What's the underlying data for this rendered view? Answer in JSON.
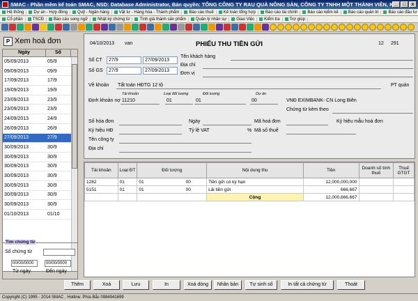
{
  "window": {
    "title": "SMAC - Phần mềm kế toán SMAC, NSD: Database Administrator, Bản quyền: TỔNG CÔNG TY RAU QUẢ NÔNG SẢN, CÔNG TY TNHH MỘT THÀNH VIÊN, K...",
    "minimize": "_",
    "maximize": "□",
    "close": "x"
  },
  "menu1": [
    "Hệ thống",
    "Dự án - Hợp đồng",
    "Quỹ - Ngân hàng",
    "Vật tư - Hàng hóa - Thành phẩm",
    "Báo cáo thuế",
    "Kế toán tổng hợp",
    "Báo cáo tài chính",
    "Báo cáo kiểm kê",
    "Báo cáo quản trị",
    "Báo cáo đầu tư - XDCB"
  ],
  "menu2": [
    "Cổ phần",
    "TSCĐ",
    "Báo cáo song ngữ",
    "Nhật ký chứng từ",
    "Tình giá thành sản phẩm",
    "Quản lý nhân sự",
    "Giao Việc",
    "Kiểm tra",
    "Trợ giúp"
  ],
  "left": {
    "p_button": "P",
    "title": "Xem hoá đơn",
    "col_date": "Ngày",
    "col_num": "Số",
    "rows": [
      {
        "date": "05/09/2013",
        "num": "05/9"
      },
      {
        "date": "09/09/2013",
        "num": "09/9"
      },
      {
        "date": "17/09/2013",
        "num": "17/9"
      },
      {
        "date": "19/09/2013",
        "num": "19/9"
      },
      {
        "date": "23/09/2013",
        "num": "23/9"
      },
      {
        "date": "23/09/2013",
        "num": "23/9"
      },
      {
        "date": "24/09/2013",
        "num": "24/9"
      },
      {
        "date": "26/09/2013",
        "num": "26/9"
      },
      {
        "date": "27/09/2013",
        "num": "27/9"
      },
      {
        "date": "30/09/2013",
        "num": "30/9"
      },
      {
        "date": "30/09/2013",
        "num": "30/9"
      },
      {
        "date": "30/09/2013",
        "num": "30/9"
      },
      {
        "date": "30/09/2013",
        "num": "30/9"
      },
      {
        "date": "30/09/2013",
        "num": "30/9"
      },
      {
        "date": "30/09/2013",
        "num": "30/9"
      },
      {
        "date": "30/09/2013",
        "num": "30/9"
      },
      {
        "date": "01/10/2013",
        "num": "01/10"
      }
    ],
    "selected_index": 8,
    "search": {
      "legend": "Tìm chứng từ",
      "so_chung_tu_label": "Số chứng từ",
      "so_chung_tu_value": "",
      "tu_ngay_value": "00/00/0000",
      "den_ngay_value": "00/00/0000",
      "tu_ngay_label": "Từ ngày",
      "den_ngay_label": "Đến ngày"
    }
  },
  "form": {
    "header_date": "04/10/2013",
    "header_user": "van",
    "title": "PHIẾU THU TIỀN GỬI",
    "page_a": "12",
    "page_b": "291",
    "so_ct_label": "Số CT",
    "so_ct_value": "27/9",
    "so_ct_date": "27/09/2013",
    "so_gs_label": "Số GS",
    "so_gs_value": "27/9",
    "so_gs_date": "27/09/2013",
    "ten_kh_label": "Tên khách hàng",
    "dia_chi_label": "Địa chỉ",
    "don_vi_label": "Đơn vị",
    "ve_khoan_label": "Về khoản",
    "ve_khoan_value": "Tất toán HĐTG 12 tộ",
    "pt_quan_label": "PT quản",
    "sub_tai_khoan": "Tài khoản",
    "sub_loai_dt": "Loại đối tượng",
    "sub_doi_tuong": "Đối tượng",
    "sub_du_an": "Dự án",
    "dinh_khoan_label": "Định khoản nợ",
    "tk_value": "11210",
    "loai_value": "01",
    "dt_value": "01",
    "da_value": "00",
    "bank_value": "VNĐ EXIMBANK- CN Long Biên",
    "ctkt_label": "Chứng từ kèm theo",
    "so_hoa_don_label": "Số hóa đơn",
    "ngay_label": "Ngày",
    "ma_hoa_don_label": "Mã hoá đơn",
    "ky_hieu_mau_label": "Ký hiệu mẫu hoá đơn",
    "ky_hieu_hd_label": "Ký hiệu HĐ",
    "ty_le_vat_label": "Tỷ lệ VAT",
    "percent": "%",
    "ma_so_thue_label": "Mã số thuế",
    "ten_cong_ty_label": "Tên công ty",
    "dia_chi2_label": "Địa chỉ"
  },
  "grid": {
    "headers": [
      "Tài khoản",
      "Loại ĐT",
      "Đối tượng",
      "Nội dung thu",
      "Tiền",
      "Doanh số tính thuế",
      "Thuế GTGT"
    ],
    "rows": [
      {
        "tk": "1282",
        "loai": "01",
        "dt1": "01",
        "dt2": "00",
        "nd": "Tiền gửi có kỳ hạn",
        "tien": "12,000,000,000"
      },
      {
        "tk": "5151",
        "loai": "01",
        "dt1": "01",
        "dt2": "00",
        "nd": "Lãi tiền gửi",
        "tien": "666,667"
      }
    ],
    "total_label": "Cộng",
    "total_value": "12,000,666,667"
  },
  "buttons": [
    "Thêm",
    "Xoá",
    "Lưu",
    "In",
    "Xoá dòng",
    "Nhân bản",
    "Tự sinh số",
    "In tất cả chứng từ",
    "Thoát"
  ],
  "status": "Copyright (C) 1995 - 2014  SMAC , Hotline: Phía Bắc 0984941699"
}
